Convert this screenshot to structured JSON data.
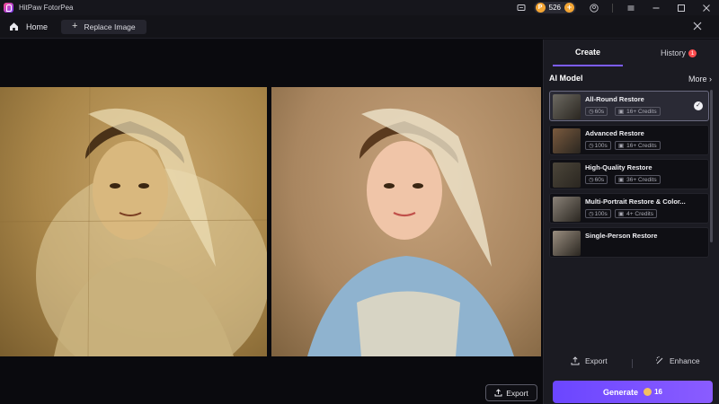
{
  "app": {
    "title": "HitPaw FotorPea"
  },
  "titlebar": {
    "credits": "526"
  },
  "toolbar": {
    "home_label": "Home",
    "replace_label": "Replace Image"
  },
  "canvas": {
    "export_label": "Export"
  },
  "panel": {
    "tab_create": "Create",
    "tab_history": "History",
    "history_badge": "1",
    "ai_model_label": "AI Model",
    "more_label": "More",
    "models": [
      {
        "name": "All-Round Restore",
        "time": "60s",
        "credits": "16+ Credits",
        "selected": true
      },
      {
        "name": "Advanced Restore",
        "time": "100s",
        "credits": "16+ Credits",
        "selected": false
      },
      {
        "name": "High-Quality Restore",
        "time": "60s",
        "credits": "36+ Credits",
        "selected": false
      },
      {
        "name": "Multi-Portrait Restore & Color...",
        "time": "100s",
        "credits": "4+ Credits",
        "selected": false
      },
      {
        "name": "Single-Person Restore",
        "time": "",
        "credits": "",
        "selected": false
      }
    ],
    "export_label": "Export",
    "enhance_label": "Enhance",
    "generate_label": "Generate",
    "generate_cost": "16"
  },
  "colors": {
    "accent": "#7c5cff",
    "coin": "#f3a534",
    "badge": "#ff4d4f"
  }
}
